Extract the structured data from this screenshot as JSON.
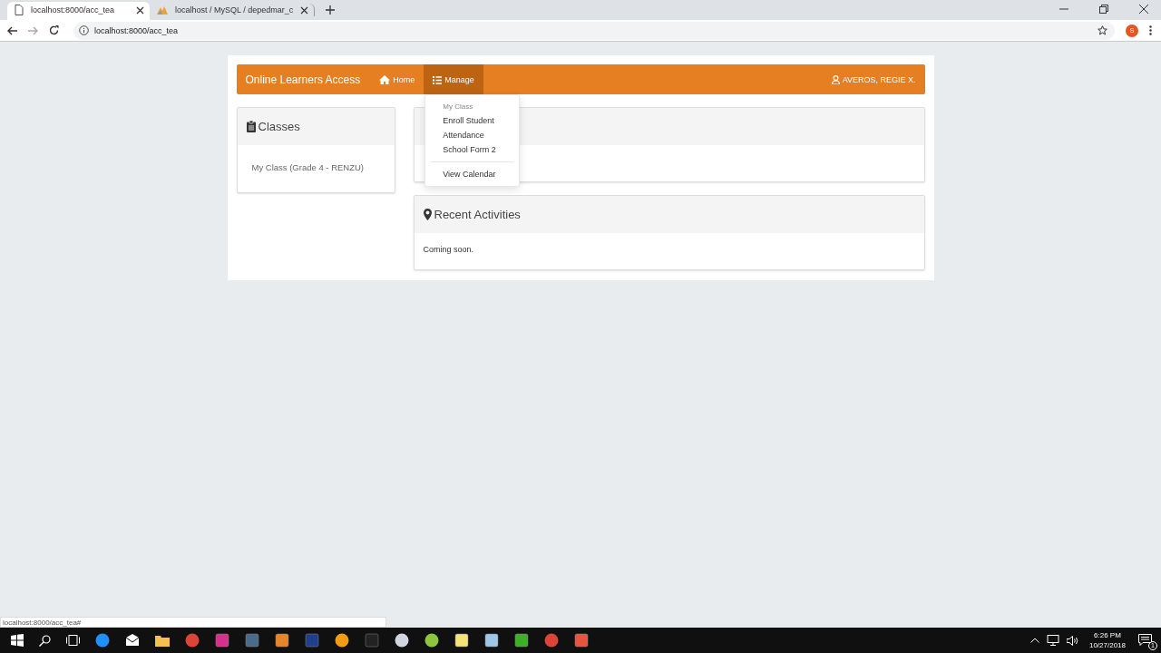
{
  "browser": {
    "tabs": [
      {
        "title": "localhost:8000/acc_tea",
        "selected": true,
        "kind": "page"
      },
      {
        "title": "localhost / MySQL / depedmar_c",
        "selected": false,
        "kind": "db"
      }
    ],
    "address": "localhost:8000/acc_tea",
    "profile": "S",
    "status_url": "localhost:8000/acc_tea#"
  },
  "navbar": {
    "brand": "Online Learners Access",
    "items": [
      {
        "label": "Home",
        "kind": "home",
        "selected": false
      },
      {
        "label": "Manage",
        "kind": "list",
        "selected": true
      }
    ],
    "user": "AVEROS, REGIE X."
  },
  "dropdown": {
    "items": [
      {
        "kind": "header",
        "label": "My Class"
      },
      {
        "kind": "item",
        "label": "Enroll Student"
      },
      {
        "kind": "item",
        "label": "Attendance"
      },
      {
        "kind": "item",
        "label": "School Form 2"
      },
      {
        "kind": "divider"
      },
      {
        "kind": "item",
        "label": "View Calendar"
      }
    ]
  },
  "classes": {
    "title": "Classes",
    "items": [
      "My Class (Grade 4 - RENZU)"
    ]
  },
  "panels": [
    {
      "kind": "covered"
    },
    {
      "kind": "text",
      "title": "Recent Activities",
      "body": "Coming soon."
    }
  ],
  "taskbar": {
    "time": "6:26 PM",
    "date": "10/27/2018",
    "notifications": "1"
  }
}
